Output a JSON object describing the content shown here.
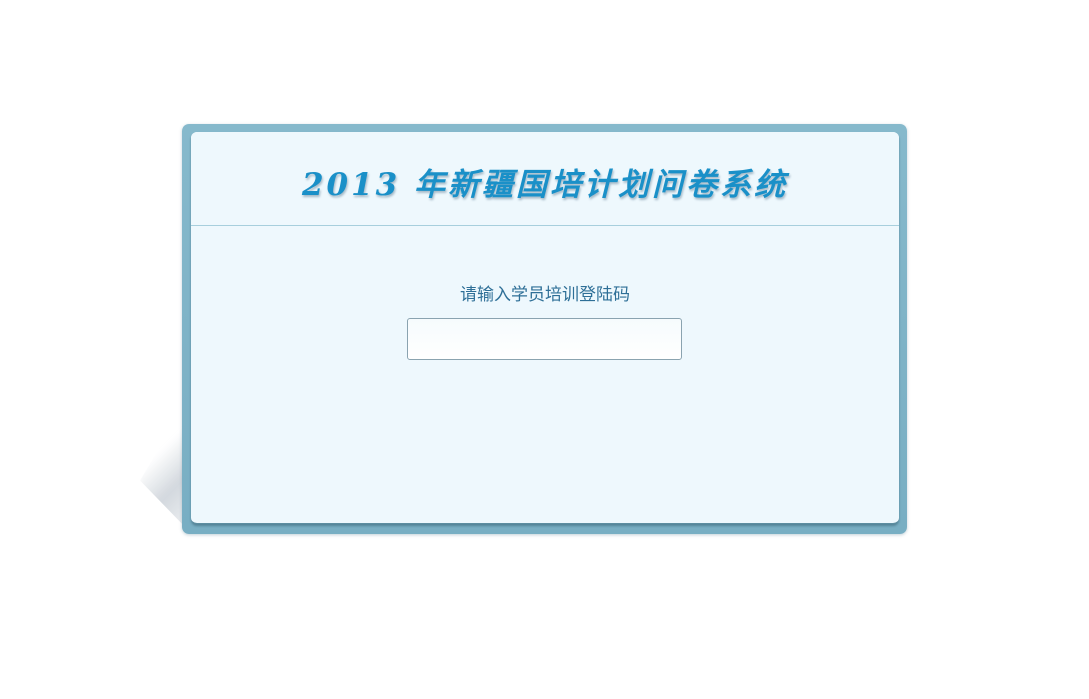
{
  "login": {
    "title": "2013 年新疆国培计划问卷系统",
    "prompt": "请输入学员培训登陆码",
    "code_input": {
      "value": "",
      "placeholder": ""
    }
  },
  "colors": {
    "title": "#1a90c8",
    "frame": "#7fb3c7",
    "panel": "#eef8fd",
    "prompt_text": "#2e6f97"
  }
}
